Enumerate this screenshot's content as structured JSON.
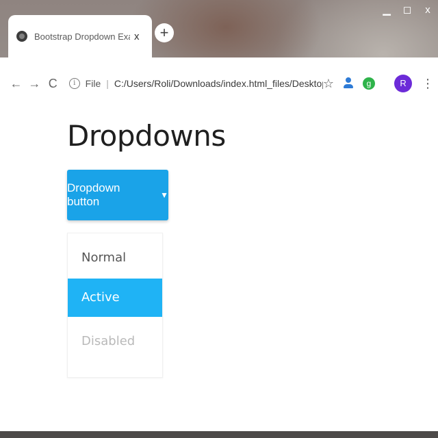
{
  "window": {
    "minimize": "▁",
    "maximize": "◻",
    "close": "x"
  },
  "tab": {
    "title": "Bootstrap Dropdown Example",
    "close": "x"
  },
  "new_tab": "+",
  "toolbar": {
    "back": "←",
    "forward": "→",
    "reload": "C",
    "info_icon": "i",
    "file_label": "File",
    "separator": "|",
    "url": "C:/Users/Roli/Downloads/index.html_files/Desktop/B...",
    "star": "☆",
    "ext_green": "g",
    "avatar_letter": "R",
    "menu": "⋮"
  },
  "page": {
    "title": "Dropdowns",
    "dropdown_button": "Dropdown button",
    "caret": "▼",
    "items": [
      {
        "label": "Normal",
        "state": "normal"
      },
      {
        "label": "Active",
        "state": "active"
      },
      {
        "label": "Disabled",
        "state": "disabled"
      }
    ]
  },
  "colors": {
    "primary": "#1aa3e8",
    "active_item": "#1fb3f5",
    "avatar": "#6c2bd8",
    "ext_green": "#2eb34a",
    "ext_blue": "#2e7bd6"
  }
}
